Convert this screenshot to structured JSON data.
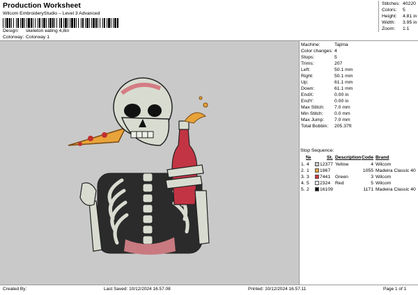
{
  "header": {
    "title": "Production Worksheet",
    "subtitle": "Wilcom EmbroideryStudio – Level 3 Advanced",
    "design_label": "Design:",
    "design_value": "skeleton eating 4,8in",
    "colorway_label": "Colorway:",
    "colorway_value": "Colorway 1"
  },
  "stats": [
    {
      "k": "Stitches:",
      "v": "40220"
    },
    {
      "k": "Colors:",
      "v": "5"
    },
    {
      "k": "Height:",
      "v": "4.81 in"
    },
    {
      "k": "Width:",
      "v": "3.95 in"
    },
    {
      "k": "Zoom:",
      "v": "1:1"
    }
  ],
  "info": [
    {
      "k": "Machine:",
      "v": "Tajima"
    },
    {
      "k": "Color changes:",
      "v": "4"
    },
    {
      "k": "Stops:",
      "v": "5"
    },
    {
      "k": "Trims:",
      "v": "207"
    },
    {
      "k": "Left:",
      "v": "50.1 mm"
    },
    {
      "k": "Right:",
      "v": "50.1 mm"
    },
    {
      "k": "Up:",
      "v": "61.1 mm"
    },
    {
      "k": "Down:",
      "v": "61.1 mm"
    },
    {
      "k": "EndX:",
      "v": "0.00 in"
    },
    {
      "k": "EndY:",
      "v": "0.00 in"
    },
    {
      "k": "Max Stitch:",
      "v": "7.0 mm"
    },
    {
      "k": "Min Stitch:",
      "v": "0.0 mm"
    },
    {
      "k": "Max Jump:",
      "v": "7.0 mm"
    },
    {
      "k": "Total Bobbin:",
      "v": "205.37ft"
    }
  ],
  "stop_sequence": {
    "title": "Stop Sequence:",
    "headers": {
      "n": "№",
      "st": "St.",
      "desc": "Description",
      "code": "Code",
      "brand": "Brand"
    },
    "rows": [
      {
        "n": "1.",
        "c": "4",
        "color": "#c9c9c9",
        "st": "12377",
        "desc": "Yellow",
        "code": "4",
        "brand": "Wilcom"
      },
      {
        "n": "2.",
        "c": "1",
        "color": "#e8a33a",
        "st": "1967",
        "desc": "",
        "code": "1055",
        "brand": "Madeira Classic 40"
      },
      {
        "n": "3.",
        "c": "3",
        "color": "#d4343f",
        "st": "7441",
        "desc": "Green",
        "code": "3",
        "brand": "Wilcom"
      },
      {
        "n": "4.",
        "c": "5",
        "color": "#ffffff",
        "st": "2324",
        "desc": "Red",
        "code": "5",
        "brand": "Wilcom"
      },
      {
        "n": "5.",
        "c": "2",
        "color": "#111111",
        "st": "16109",
        "desc": "",
        "code": "1171",
        "brand": "Madeira Classic 40"
      }
    ]
  },
  "footer": {
    "created_by": "Created By:",
    "last_saved": "Last Saved: 10/12/2024 16.57.08",
    "printed": "Printed: 10/12/2024 16.57.11",
    "page": "Page 1 of 1"
  }
}
